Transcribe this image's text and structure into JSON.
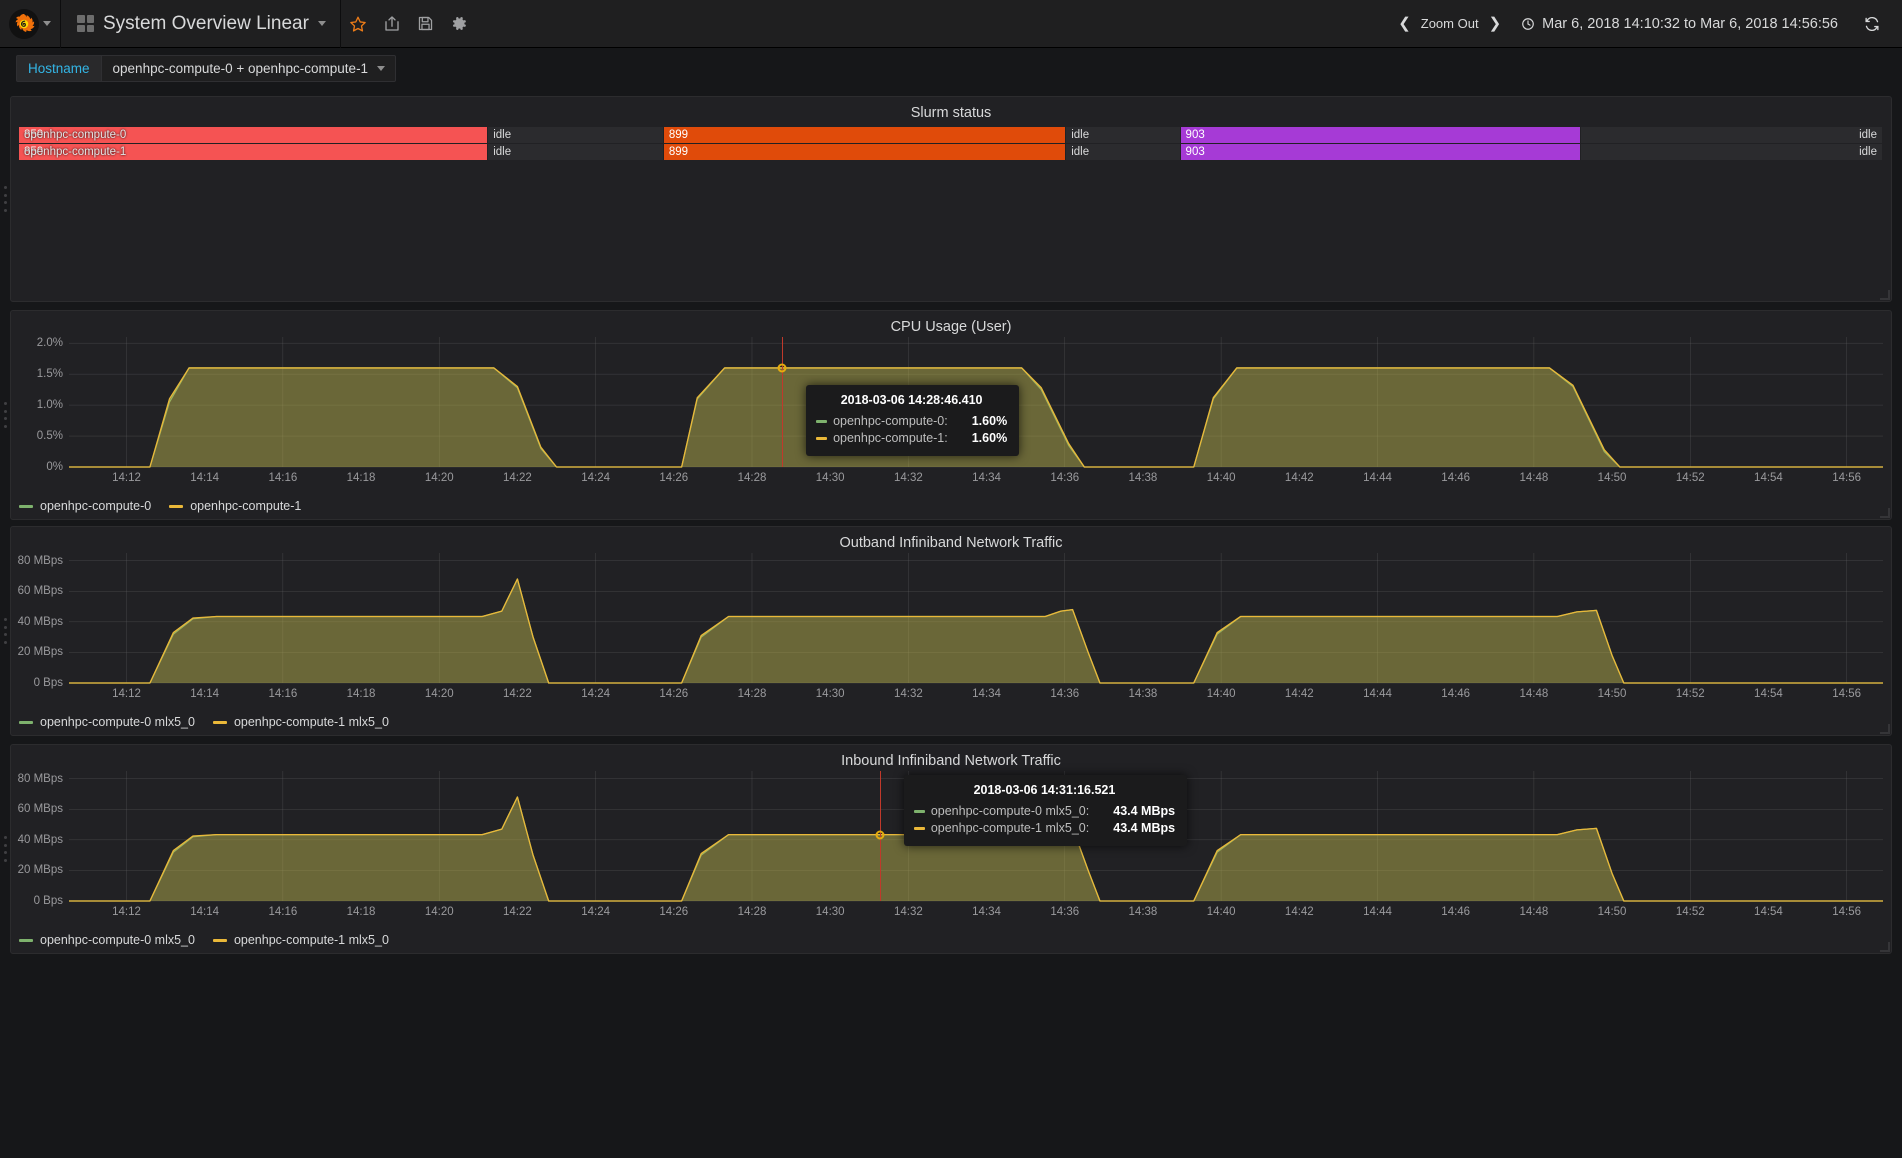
{
  "navbar": {
    "logo_icon": "grafana-logo-icon",
    "logo_caret_icon": "chevron-down-icon",
    "dashboard_icon": "dashboard-grid-icon",
    "title": "System Overview Linear",
    "title_caret_icon": "chevron-down-icon",
    "star_icon": "star-icon",
    "share_icon": "share-icon",
    "save_icon": "save-icon",
    "settings_icon": "gear-icon",
    "zoom_out_label": "Zoom Out",
    "zoom_back_icon": "chevron-left-icon",
    "zoom_forward_icon": "chevron-right-icon",
    "clock_icon": "clock-icon",
    "time_range": "Mar 6, 2018 14:10:32 to Mar 6, 2018 14:56:56",
    "refresh_icon": "refresh-icon"
  },
  "submenu": {
    "variable_label": "Hostname",
    "variable_value": "openhpc-compute-0 + openhpc-compute-1",
    "variable_caret_icon": "chevron-down-icon"
  },
  "colors": {
    "series_green": "#7eb26d",
    "series_yellow": "#eab839",
    "state_red": "#f55353",
    "state_orange": "#e04b0a",
    "state_purple": "#a63ad6",
    "state_idle": "#2b2b2e",
    "crosshair": "#c0392b",
    "accent_blue": "#33b5e5",
    "panel_bg": "#212124",
    "page_bg": "#161719"
  },
  "panels": [
    {
      "id": "slurm",
      "title": "Slurm status",
      "type": "discrete",
      "rows": [
        {
          "name": "openhpc-compute-0",
          "segments": [
            {
              "label": "850",
              "color": "#f55353",
              "width_pct": 25.2,
              "align": "left"
            },
            {
              "label": "idle",
              "color": "#2b2b2e",
              "width_pct": 9.4,
              "align": "left"
            },
            {
              "label": "899",
              "color": "#e04b0a",
              "width_pct": 21.6,
              "align": "left"
            },
            {
              "label": "idle",
              "color": "#2b2b2e",
              "width_pct": 6.1,
              "align": "left"
            },
            {
              "label": "903",
              "color": "#a63ad6",
              "width_pct": 21.5,
              "align": "left"
            },
            {
              "label": "idle",
              "color": "#2b2b2e",
              "width_pct": 16.2,
              "align": "left"
            }
          ]
        },
        {
          "name": "openhpc-compute-1",
          "segments": [
            {
              "label": "850",
              "color": "#f55353",
              "width_pct": 25.2,
              "align": "left"
            },
            {
              "label": "idle",
              "color": "#2b2b2e",
              "width_pct": 9.4,
              "align": "left"
            },
            {
              "label": "899",
              "color": "#e04b0a",
              "width_pct": 21.6,
              "align": "left"
            },
            {
              "label": "idle",
              "color": "#2b2b2e",
              "width_pct": 6.1,
              "align": "left"
            },
            {
              "label": "903",
              "color": "#a63ad6",
              "width_pct": 21.5,
              "align": "left"
            },
            {
              "label": "idle",
              "color": "#2b2b2e",
              "width_pct": 16.2,
              "align": "left"
            }
          ]
        }
      ]
    },
    {
      "id": "cpu",
      "title": "CPU Usage (User)",
      "type": "graph"
    },
    {
      "id": "outband",
      "title": "Outband Infiniband Network Traffic",
      "type": "graph"
    },
    {
      "id": "inband",
      "title": "Inbound Infiniband Network Traffic",
      "type": "graph"
    }
  ],
  "chart_data": [
    {
      "id": "cpu",
      "type": "area",
      "title": "CPU Usage (User)",
      "xlabel": "",
      "ylabel": "",
      "ylim": [
        0,
        2.1
      ],
      "grid": true,
      "legend_position": "bottom-left",
      "yticks": [
        "0%",
        "0.5%",
        "1.0%",
        "1.5%",
        "2.0%"
      ],
      "ytick_values": [
        0,
        0.5,
        1.0,
        1.5,
        2.0
      ],
      "xticks": [
        "14:12",
        "14:14",
        "14:16",
        "14:18",
        "14:20",
        "14:22",
        "14:24",
        "14:26",
        "14:28",
        "14:30",
        "14:32",
        "14:34",
        "14:36",
        "14:38",
        "14:40",
        "14:42",
        "14:44",
        "14:46",
        "14:48",
        "14:50",
        "14:52",
        "14:54",
        "14:56"
      ],
      "x_minutes": [
        12,
        14,
        16,
        18,
        20,
        22,
        24,
        26,
        28,
        30,
        32,
        34,
        36,
        38,
        40,
        42,
        44,
        46,
        48,
        50,
        52,
        54,
        56
      ],
      "x_range_minutes": [
        10.53,
        56.93
      ],
      "series": [
        {
          "name": "openhpc-compute-0",
          "color": "#7eb26d",
          "points": [
            [
              10.53,
              0
            ],
            [
              12.6,
              0
            ],
            [
              13.1,
              1.05
            ],
            [
              13.6,
              1.6
            ],
            [
              14.0,
              1.6
            ],
            [
              21.4,
              1.6
            ],
            [
              22.0,
              1.28
            ],
            [
              22.6,
              0.3
            ],
            [
              23.0,
              0
            ],
            [
              26.2,
              0
            ],
            [
              26.6,
              1.1
            ],
            [
              27.3,
              1.6
            ],
            [
              34.9,
              1.6
            ],
            [
              35.4,
              1.25
            ],
            [
              36.1,
              0.35
            ],
            [
              36.5,
              0
            ],
            [
              39.3,
              0
            ],
            [
              39.8,
              1.1
            ],
            [
              40.4,
              1.6
            ],
            [
              48.4,
              1.6
            ],
            [
              49.0,
              1.3
            ],
            [
              49.8,
              0.25
            ],
            [
              50.2,
              0
            ],
            [
              56.93,
              0
            ]
          ]
        },
        {
          "name": "openhpc-compute-1",
          "color": "#eab839",
          "points": [
            [
              10.53,
              0
            ],
            [
              12.6,
              0
            ],
            [
              13.1,
              1.1
            ],
            [
              13.6,
              1.6
            ],
            [
              14.0,
              1.6
            ],
            [
              21.4,
              1.6
            ],
            [
              22.0,
              1.3
            ],
            [
              22.6,
              0.32
            ],
            [
              23.0,
              0
            ],
            [
              26.2,
              0
            ],
            [
              26.6,
              1.12
            ],
            [
              27.3,
              1.6
            ],
            [
              34.9,
              1.6
            ],
            [
              35.4,
              1.28
            ],
            [
              36.1,
              0.38
            ],
            [
              36.5,
              0
            ],
            [
              39.3,
              0
            ],
            [
              39.8,
              1.12
            ],
            [
              40.4,
              1.6
            ],
            [
              48.4,
              1.6
            ],
            [
              49.0,
              1.32
            ],
            [
              49.8,
              0.28
            ],
            [
              50.2,
              0
            ],
            [
              56.93,
              0
            ]
          ]
        }
      ],
      "tooltip": {
        "time": "2018-03-06 14:28:46.410",
        "x_minute": 28.77,
        "rows": [
          {
            "label": "openhpc-compute-0:",
            "value": "1.60%",
            "color": "#7eb26d"
          },
          {
            "label": "openhpc-compute-1:",
            "value": "1.60%",
            "color": "#eab839"
          }
        ]
      },
      "hover_dot": {
        "x_minute": 28.77,
        "y": 1.6
      }
    },
    {
      "id": "outband",
      "type": "area",
      "title": "Outband Infiniband Network Traffic",
      "xlabel": "",
      "ylabel": "",
      "ylim": [
        0,
        85
      ],
      "grid": true,
      "legend_position": "bottom-left",
      "yticks": [
        "0 Bps",
        "20 MBps",
        "40 MBps",
        "60 MBps",
        "80 MBps"
      ],
      "ytick_values": [
        0,
        20,
        40,
        60,
        80
      ],
      "xticks": [
        "14:12",
        "14:14",
        "14:16",
        "14:18",
        "14:20",
        "14:22",
        "14:24",
        "14:26",
        "14:28",
        "14:30",
        "14:32",
        "14:34",
        "14:36",
        "14:38",
        "14:40",
        "14:42",
        "14:44",
        "14:46",
        "14:48",
        "14:50",
        "14:52",
        "14:54",
        "14:56"
      ],
      "x_minutes": [
        12,
        14,
        16,
        18,
        20,
        22,
        24,
        26,
        28,
        30,
        32,
        34,
        36,
        38,
        40,
        42,
        44,
        46,
        48,
        50,
        52,
        54,
        56
      ],
      "x_range_minutes": [
        10.53,
        56.93
      ],
      "series": [
        {
          "name": "openhpc-compute-0 mlx5_0",
          "color": "#7eb26d",
          "points": [
            [
              10.53,
              0
            ],
            [
              12.6,
              0
            ],
            [
              13.2,
              32
            ],
            [
              13.7,
              42
            ],
            [
              14.3,
              43.5
            ],
            [
              21.1,
              43.5
            ],
            [
              21.6,
              47
            ],
            [
              22.0,
              68
            ],
            [
              22.4,
              30
            ],
            [
              22.8,
              0
            ],
            [
              26.2,
              0
            ],
            [
              26.7,
              30
            ],
            [
              27.4,
              43.5
            ],
            [
              35.5,
              43.5
            ],
            [
              35.9,
              47
            ],
            [
              36.2,
              48
            ],
            [
              36.6,
              20
            ],
            [
              36.9,
              0
            ],
            [
              39.3,
              0
            ],
            [
              39.9,
              32
            ],
            [
              40.5,
              43.5
            ],
            [
              48.6,
              43.5
            ],
            [
              49.1,
              46.5
            ],
            [
              49.6,
              47.5
            ],
            [
              50.0,
              18
            ],
            [
              50.3,
              0
            ],
            [
              56.93,
              0
            ]
          ]
        },
        {
          "name": "openhpc-compute-1 mlx5_0",
          "color": "#eab839",
          "points": [
            [
              10.53,
              0
            ],
            [
              12.6,
              0
            ],
            [
              13.2,
              33
            ],
            [
              13.7,
              42.5
            ],
            [
              14.3,
              43.5
            ],
            [
              21.1,
              43.5
            ],
            [
              21.6,
              47
            ],
            [
              22.0,
              68
            ],
            [
              22.4,
              30
            ],
            [
              22.8,
              0
            ],
            [
              26.2,
              0
            ],
            [
              26.7,
              31
            ],
            [
              27.4,
              43.5
            ],
            [
              35.5,
              43.5
            ],
            [
              35.9,
              47
            ],
            [
              36.2,
              48
            ],
            [
              36.6,
              20
            ],
            [
              36.9,
              0
            ],
            [
              39.3,
              0
            ],
            [
              39.9,
              33
            ],
            [
              40.5,
              43.5
            ],
            [
              48.6,
              43.5
            ],
            [
              49.1,
              46.5
            ],
            [
              49.6,
              47.5
            ],
            [
              50.0,
              18
            ],
            [
              50.3,
              0
            ],
            [
              56.93,
              0
            ]
          ]
        }
      ]
    },
    {
      "id": "inband",
      "type": "area",
      "title": "Inbound Infiniband Network Traffic",
      "xlabel": "",
      "ylabel": "",
      "ylim": [
        0,
        85
      ],
      "grid": true,
      "legend_position": "bottom-left",
      "yticks": [
        "0 Bps",
        "20 MBps",
        "40 MBps",
        "60 MBps",
        "80 MBps"
      ],
      "ytick_values": [
        0,
        20,
        40,
        60,
        80
      ],
      "xticks": [
        "14:12",
        "14:14",
        "14:16",
        "14:18",
        "14:20",
        "14:22",
        "14:24",
        "14:26",
        "14:28",
        "14:30",
        "14:32",
        "14:34",
        "14:36",
        "14:38",
        "14:40",
        "14:42",
        "14:44",
        "14:46",
        "14:48",
        "14:50",
        "14:52",
        "14:54",
        "14:56"
      ],
      "x_minutes": [
        12,
        14,
        16,
        18,
        20,
        22,
        24,
        26,
        28,
        30,
        32,
        34,
        36,
        38,
        40,
        42,
        44,
        46,
        48,
        50,
        52,
        54,
        56
      ],
      "x_range_minutes": [
        10.53,
        56.93
      ],
      "series": [
        {
          "name": "openhpc-compute-0 mlx5_0",
          "color": "#7eb26d",
          "points": [
            [
              10.53,
              0
            ],
            [
              12.6,
              0
            ],
            [
              13.2,
              32
            ],
            [
              13.7,
              42
            ],
            [
              14.3,
              43.4
            ],
            [
              21.1,
              43.4
            ],
            [
              21.6,
              47
            ],
            [
              22.0,
              68
            ],
            [
              22.4,
              30
            ],
            [
              22.8,
              0
            ],
            [
              26.2,
              0
            ],
            [
              26.7,
              30
            ],
            [
              27.4,
              43.4
            ],
            [
              35.5,
              43.4
            ],
            [
              35.9,
              47
            ],
            [
              36.2,
              48
            ],
            [
              36.6,
              20
            ],
            [
              36.9,
              0
            ],
            [
              39.3,
              0
            ],
            [
              39.9,
              32
            ],
            [
              40.5,
              43.4
            ],
            [
              48.6,
              43.4
            ],
            [
              49.1,
              46.5
            ],
            [
              49.6,
              47.5
            ],
            [
              50.0,
              18
            ],
            [
              50.3,
              0
            ],
            [
              56.93,
              0
            ]
          ]
        },
        {
          "name": "openhpc-compute-1 mlx5_0",
          "color": "#eab839",
          "points": [
            [
              10.53,
              0
            ],
            [
              12.6,
              0
            ],
            [
              13.2,
              33
            ],
            [
              13.7,
              42.5
            ],
            [
              14.3,
              43.4
            ],
            [
              21.1,
              43.4
            ],
            [
              21.6,
              47
            ],
            [
              22.0,
              68
            ],
            [
              22.4,
              30
            ],
            [
              22.8,
              0
            ],
            [
              26.2,
              0
            ],
            [
              26.7,
              31
            ],
            [
              27.4,
              43.4
            ],
            [
              35.5,
              43.4
            ],
            [
              35.9,
              47
            ],
            [
              36.2,
              48
            ],
            [
              36.6,
              20
            ],
            [
              36.9,
              0
            ],
            [
              39.3,
              0
            ],
            [
              39.9,
              33
            ],
            [
              40.5,
              43.4
            ],
            [
              48.6,
              43.4
            ],
            [
              49.1,
              46.5
            ],
            [
              49.6,
              47.5
            ],
            [
              50.0,
              18
            ],
            [
              50.3,
              0
            ],
            [
              56.93,
              0
            ]
          ]
        }
      ],
      "tooltip": {
        "time": "2018-03-06 14:31:16.521",
        "x_minute": 31.27,
        "rows": [
          {
            "label": "openhpc-compute-0 mlx5_0:",
            "value": "43.4 MBps",
            "color": "#7eb26d"
          },
          {
            "label": "openhpc-compute-1 mlx5_0:",
            "value": "43.4 MBps",
            "color": "#eab839"
          }
        ]
      },
      "hover_dot": {
        "x_minute": 31.27,
        "y": 43.4
      }
    }
  ]
}
